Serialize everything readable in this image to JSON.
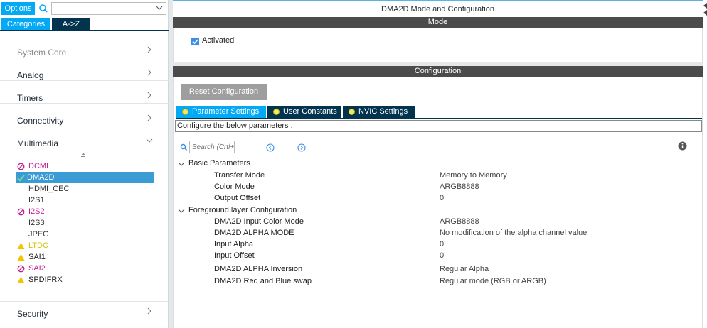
{
  "left": {
    "options_label": "Options",
    "categories_tab": "Categories",
    "az_tab": "A->Z",
    "categories": [
      {
        "label": "System Core",
        "enabled": false
      },
      {
        "label": "Analog",
        "enabled": true
      },
      {
        "label": "Timers",
        "enabled": true
      },
      {
        "label": "Connectivity",
        "enabled": true
      },
      {
        "label": "Multimedia",
        "enabled": true,
        "expanded": true
      },
      {
        "label": "Security",
        "enabled": true
      }
    ],
    "multimedia_items": [
      {
        "label": "DCMI",
        "status": "error"
      },
      {
        "label": "DMA2D",
        "status": "ok",
        "selected": true
      },
      {
        "label": "HDMI_CEC",
        "status": "none"
      },
      {
        "label": "I2S1",
        "status": "none"
      },
      {
        "label": "I2S2",
        "status": "error"
      },
      {
        "label": "I2S3",
        "status": "none"
      },
      {
        "label": "JPEG",
        "status": "none"
      },
      {
        "label": "LTDC",
        "status": "warning-yellow"
      },
      {
        "label": "SAI1",
        "status": "warning"
      },
      {
        "label": "SAI2",
        "status": "error"
      },
      {
        "label": "SPDIFRX",
        "status": "warning"
      }
    ]
  },
  "right": {
    "title": "DMA2D Mode and Configuration",
    "mode_header": "Mode",
    "activated_label": "Activated",
    "activated": true,
    "configuration_header": "Configuration",
    "reset_button": "Reset Configuration",
    "tabs": [
      {
        "label": "Parameter Settings",
        "active": true
      },
      {
        "label": "User Constants",
        "active": false
      },
      {
        "label": "NVIC Settings",
        "active": false
      }
    ],
    "configure_text": "Configure the below parameters :",
    "search_placeholder": "Search (Crtl+F)",
    "groups": [
      {
        "label": "Basic Parameters",
        "params": [
          {
            "name": "Transfer Mode",
            "value": "Memory to Memory"
          },
          {
            "name": "Color Mode",
            "value": "ARGB8888"
          },
          {
            "name": "Output Offset",
            "value": "0"
          }
        ]
      },
      {
        "label": "Foreground layer Configuration",
        "params": [
          {
            "name": "DMA2D Input Color Mode",
            "value": "ARGB8888"
          },
          {
            "name": "DMA2D ALPHA MODE",
            "value": "No modification of the alpha channel value"
          },
          {
            "name": "Input Alpha",
            "value": "0"
          },
          {
            "name": "Input Offset",
            "value": "0"
          },
          {
            "name": "DMA2D ALPHA Inversion",
            "value": "Regular Alpha"
          },
          {
            "name": "DMA2D Red and Blue swap",
            "value": "Regular mode (RGB or ARGB)"
          }
        ]
      }
    ]
  },
  "colors": {
    "accent": "#03a9f4",
    "dark_tab": "#03344f",
    "selected_row": "#3a9bd5",
    "error": "#c51d8e",
    "warning": "#f5c400"
  }
}
